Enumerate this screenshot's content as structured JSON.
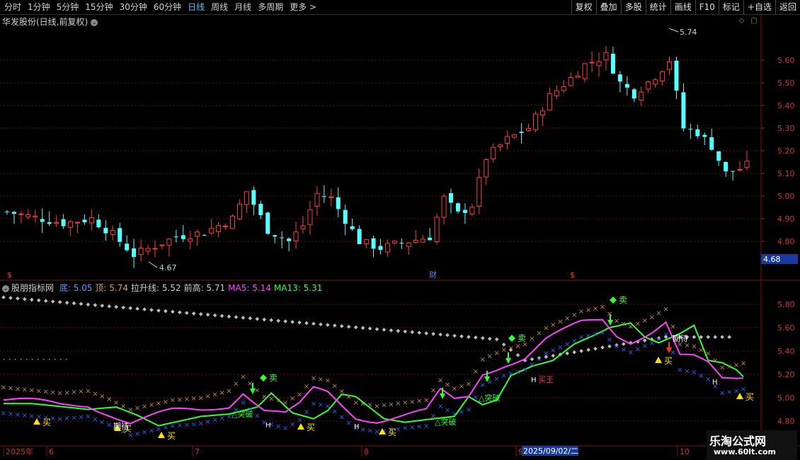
{
  "toolbar": {
    "periods": [
      "分时",
      "1分钟",
      "5分钟",
      "15分钟",
      "30分钟",
      "60分钟",
      "日线",
      "周线",
      "月线",
      "多周期",
      "更多 >"
    ],
    "active_period": "日线",
    "actions": [
      "复权",
      "叠加",
      "多股",
      "统计",
      "画线",
      "F10",
      "标记",
      "+自选",
      "返回"
    ]
  },
  "main_chart": {
    "title": "华发股份(日线,前复权)",
    "price_ticks": [
      "5.60",
      "5.50",
      "5.40",
      "5.30",
      "5.20",
      "5.10",
      "5.00",
      "4.90",
      "4.80"
    ],
    "current_price": "4.68",
    "high_label": "5.74",
    "low_label": "4.67",
    "marker_label": "财",
    "dollar_marker": "$",
    "colors": {
      "up": "#ff3c3c",
      "down": "#54ffff",
      "grid": "#7a1414"
    }
  },
  "indicator": {
    "name": "股朋指标网",
    "fields": [
      {
        "label": "底: 5.05",
        "color": "#4fa0ff"
      },
      {
        "label": "顶: 5.74",
        "color": "#e0a050"
      },
      {
        "label": "拉升线: 5.52",
        "color": "#d0d0d0"
      },
      {
        "label": "前高: 5.71",
        "color": "#d0d0d0"
      },
      {
        "label": "MA5: 5.14",
        "color": "#ff40ff"
      },
      {
        "label": "MA13: 5.31",
        "color": "#30ff30"
      }
    ],
    "ticks": [
      "5.80",
      "5.60",
      "5.40",
      "5.20",
      "5.00",
      "4.80"
    ],
    "labels": {
      "buy": "买",
      "sell": "卖",
      "breakout": "△突破",
      "hold": "待",
      "wait": "期待",
      "h": "H",
      "king": "买王"
    }
  },
  "time_axis": {
    "labels": [
      "2025年",
      "6",
      "7",
      "8",
      "9",
      "10"
    ],
    "cursor_date": "2025/09/02/二"
  },
  "watermark": {
    "name": "乐淘公式网",
    "url": "www.60lt.com"
  }
}
